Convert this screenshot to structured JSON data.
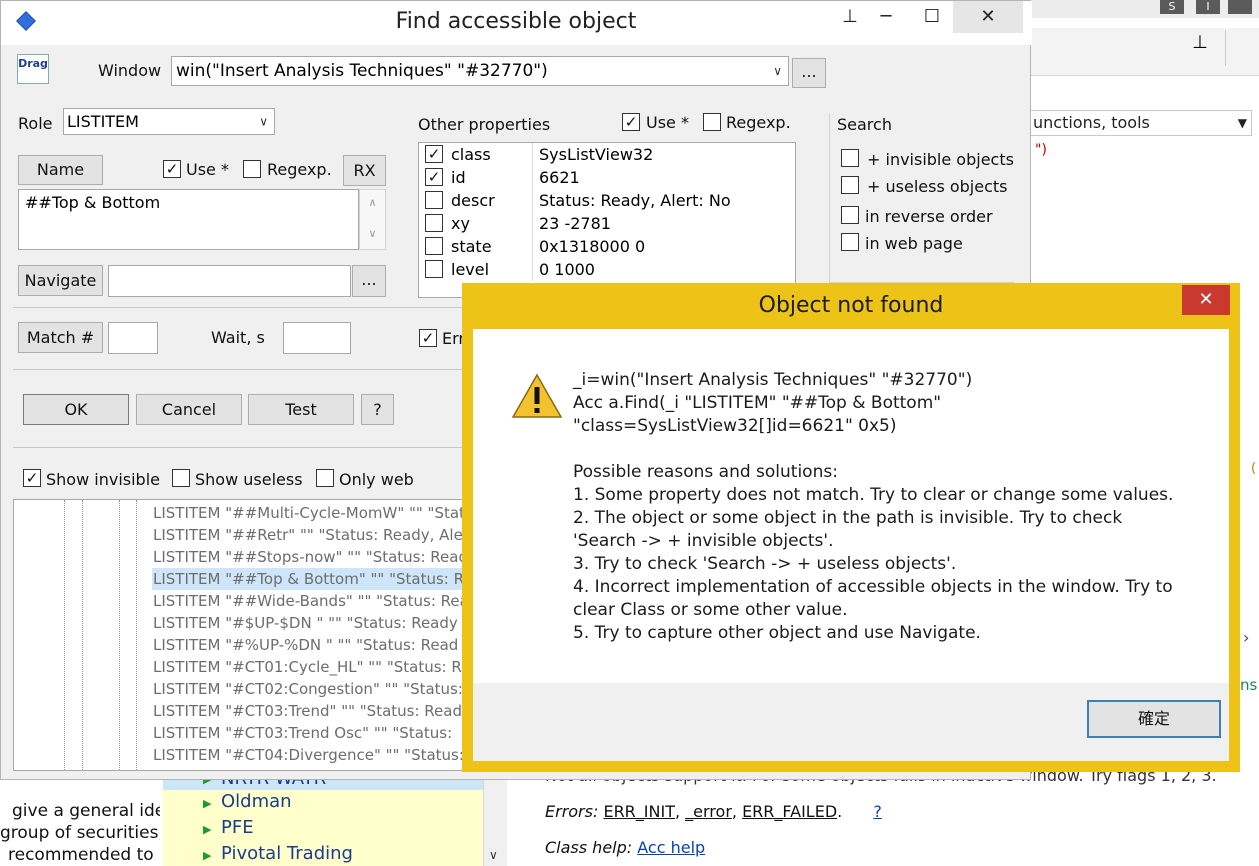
{
  "find_dialog": {
    "title": "Find accessible object",
    "drag_label": "Drag",
    "window_label": "Window",
    "window_value": "win(\"Insert Analysis Techniques\" \"#32770\")",
    "window_browse": "...",
    "role_label": "Role",
    "role_value": "LISTITEM",
    "name_button": "Name",
    "name_use": "Use *",
    "name_regexp": "Regexp.",
    "rx_button": "RX",
    "name_value": "##Top & Bottom",
    "navigate_button": "Navigate",
    "navigate_browse": "...",
    "match_button": "Match #",
    "wait_label": "Wait, s",
    "error_checkbox": "Error",
    "ok_button": "OK",
    "cancel_button": "Cancel",
    "test_button": "Test",
    "help_button": "?",
    "other_props_label": "Other properties",
    "other_use": "Use *",
    "other_regexp": "Regexp.",
    "properties": [
      {
        "checked": true,
        "name": "class",
        "value": "SysListView32"
      },
      {
        "checked": true,
        "name": "id",
        "value": "6621"
      },
      {
        "checked": false,
        "name": "descr",
        "value": "Status: Ready, Alert: No"
      },
      {
        "checked": false,
        "name": "xy",
        "value": "23 -2781"
      },
      {
        "checked": false,
        "name": "state",
        "value": "0x1318000 0"
      },
      {
        "checked": false,
        "name": "level",
        "value": "0 1000"
      }
    ],
    "search_label": "Search",
    "search_options": [
      "+ invisible objects",
      "+ useless objects",
      "in reverse order",
      "in web page"
    ],
    "show_invisible": "Show invisible",
    "show_useless": "Show useless",
    "only_web": "Only web",
    "tree_items": [
      "LISTITEM  \"##Multi-Cycle-MomW\"  \"\"  \"Status",
      "LISTITEM  \"##Retr\"  \"\"  \"Status: Ready, Ale",
      "LISTITEM  \"##Stops-now\"  \"\"  \"Status: Read",
      "LISTITEM  \"##Top & Bottom\"  \"\"  \"Status: R",
      "LISTITEM  \"##Wide-Bands\"  \"\"  \"Status: Rea",
      "LISTITEM  \"#$UP-$DN \"  \"\"  \"Status: Ready",
      "LISTITEM  \"#%UP-%DN \"  \"\"  \"Status: Read",
      "LISTITEM  \"#CT01:Cycle_HL\"  \"\"  \"Status: R",
      "LISTITEM  \"#CT02:Congestion\"  \"\"  \"Status:",
      "LISTITEM  \"#CT03:Trend\"  \"\"  \"Status: Read",
      "LISTITEM  \"#CT03:Trend Osc\"  \"\"  \"Status:",
      "LISTITEM  \"#CT04:Divergence\"  \"\"  \"Status:"
    ]
  },
  "message_box": {
    "title": "Object not found",
    "close_glyph": "✕",
    "lines": [
      "_i=win(\"Insert Analysis Techniques\" \"#32770\")",
      "Acc a.Find(_i \"LISTITEM\" \"##Top & Bottom\"",
      "\"class=SysListView32[]id=6621\" 0x5)",
      "",
      "Possible reasons and solutions:",
      "1. Some property does not match. Try to clear or change some values.",
      "2. The object or some object in the path is invisible. Try to check",
      "'Search -> + invisible objects'.",
      "3. Try to check 'Search -> + useless objects'.",
      "4. Incorrect implementation of accessible objects in the window. Try to",
      "clear Class or some other value.",
      "5. Try to capture other object and use Navigate."
    ],
    "ok_button": "確定"
  },
  "background": {
    "combo_text": "unctions, tools",
    "quote_text": "\")",
    "orange_char": "(",
    "green_text": "ns",
    "left_text_lines": [
      "give a general ide",
      "group of securities,",
      "recommended to"
    ],
    "yellow_list": [
      "NRTR WATR",
      "Oldman",
      "PFE",
      "Pivotal Trading"
    ],
    "help_partial": "Not all objects support it. For some objects fails in inactive window. Try flags 1, 2, 3.",
    "errors_label": "Errors:",
    "errors": [
      "ERR_INIT",
      "_error",
      "ERR_FAILED"
    ],
    "errors_help": "?",
    "class_help_label": "Class help:",
    "class_help_link": "Acc help"
  },
  "colors": {
    "dialog_bg": "#f0f0f0",
    "msgbox_frame": "#ecc316",
    "close_red": "#c9392d",
    "selection": "#cfe6fa",
    "link": "#0645ad",
    "yellow_list": "#ffffcc"
  }
}
